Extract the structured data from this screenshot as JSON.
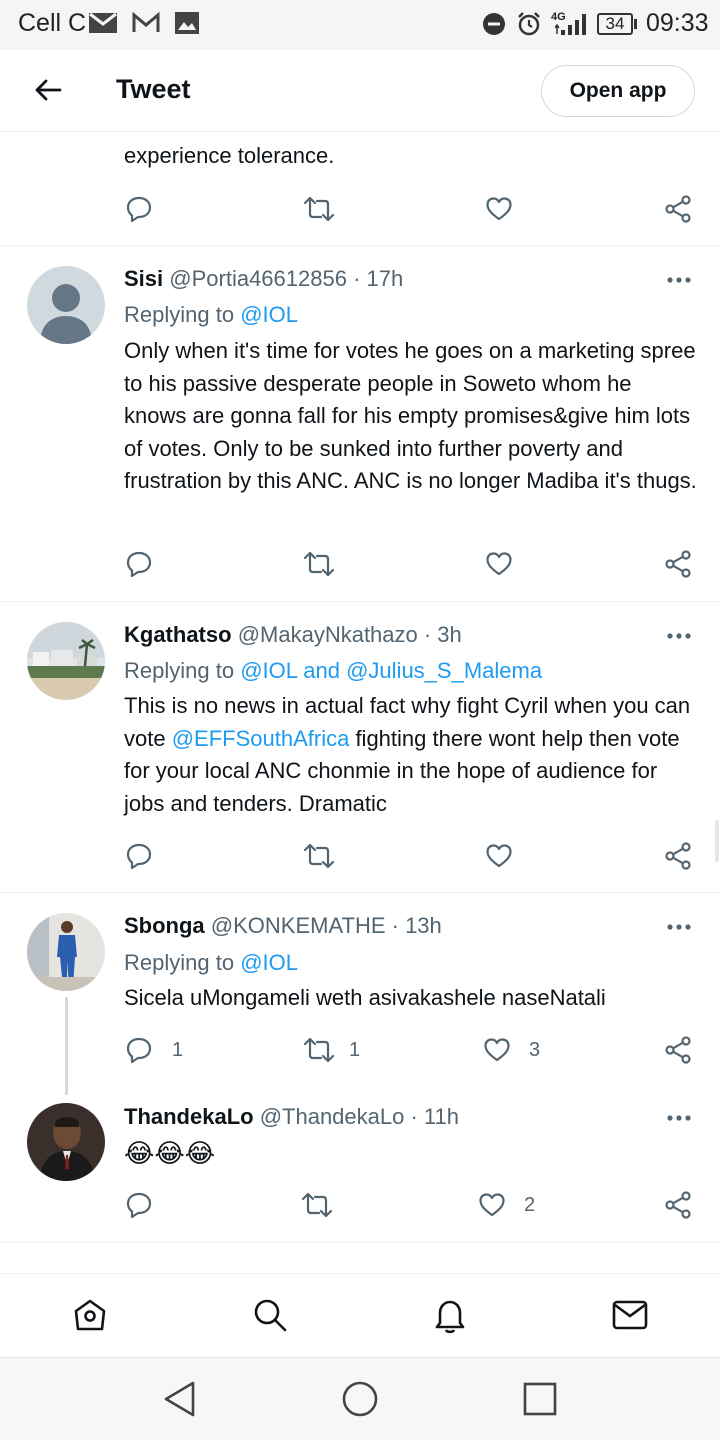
{
  "status_bar": {
    "carrier": "Cell C",
    "battery": "34",
    "time": "09:33",
    "network": "4G"
  },
  "header": {
    "title": "Tweet",
    "open_app": "Open app"
  },
  "top_tweet": {
    "text": "experience tolerance."
  },
  "replies": [
    {
      "display_name": "Sisi",
      "handle": "@Portia46612856 · 17h",
      "replying_prefix": "Replying to ",
      "replying_to": "@IOL",
      "text": "Only when it's time for votes he goes on a marketing spree to his passive desperate people in Soweto whom he knows are gonna fall for his empty promises&give him lots of votes. Only to be sunked into further poverty and frustration by this ANC. ANC is no longer Madiba it's thugs."
    },
    {
      "display_name": "Kgathatso",
      "handle": "@MakayNkathazo · 3h",
      "replying_prefix": "Replying to ",
      "replying_to": "@IOL and @Julius_S_Malema",
      "text_before": "This is no news in actual fact why fight Cyril when you can vote ",
      "mention": "@EFFSouthAfrica",
      "text_after": " fighting there wont help then vote for your local ANC chonmie in the hope of audience for jobs and tenders. Dramatic"
    },
    {
      "display_name": "Sbonga",
      "handle": "@KONKEMATHE · 13h",
      "replying_prefix": "Replying to ",
      "replying_to": "@IOL",
      "text": "Sicela uMongameli weth asivakashele naseNatali",
      "reply_count": "1",
      "retweet_count": "1",
      "like_count": "3"
    },
    {
      "display_name": "ThandekaLo",
      "handle": "@ThandekaLo · 11h",
      "text": "😂😂😂",
      "like_count": "2"
    }
  ],
  "nav": {
    "home": "home-icon",
    "search": "search-icon",
    "notifications": "bell-icon",
    "messages": "mail-icon"
  },
  "colors": {
    "link": "#1d9bf0",
    "text": "#0f1419",
    "secondary": "#536471"
  }
}
